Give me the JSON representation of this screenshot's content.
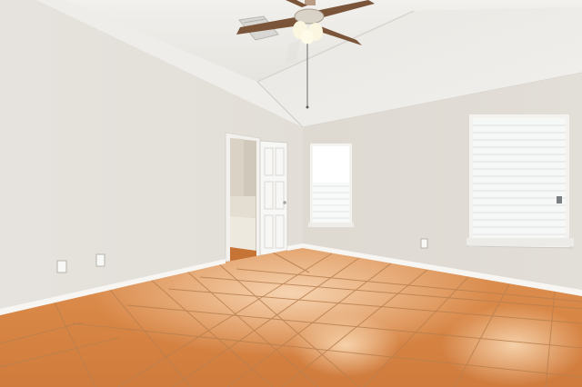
{
  "scene": {
    "kind": "empty-room-interior",
    "elements": [
      "vaulted-ceiling",
      "ceiling-fan",
      "air-vent",
      "left-wall",
      "back-wall",
      "open-doorway",
      "bathroom-glimpse",
      "door",
      "small-window",
      "large-window",
      "window-blinds",
      "tile-floor",
      "baseboards",
      "wall-outlets"
    ]
  },
  "colors": {
    "wall": "#e5e1da",
    "wall_shadow": "#d6d1c9",
    "ceiling": "#ecebe7",
    "floor": "#d9874a",
    "floor_dark": "#c26f35",
    "grout": "#b8825a",
    "trim": "#f6f5f2",
    "window_light": "#f7f8f8",
    "fan_blade": "#7a5539",
    "fan_light": "#fbf6df"
  }
}
